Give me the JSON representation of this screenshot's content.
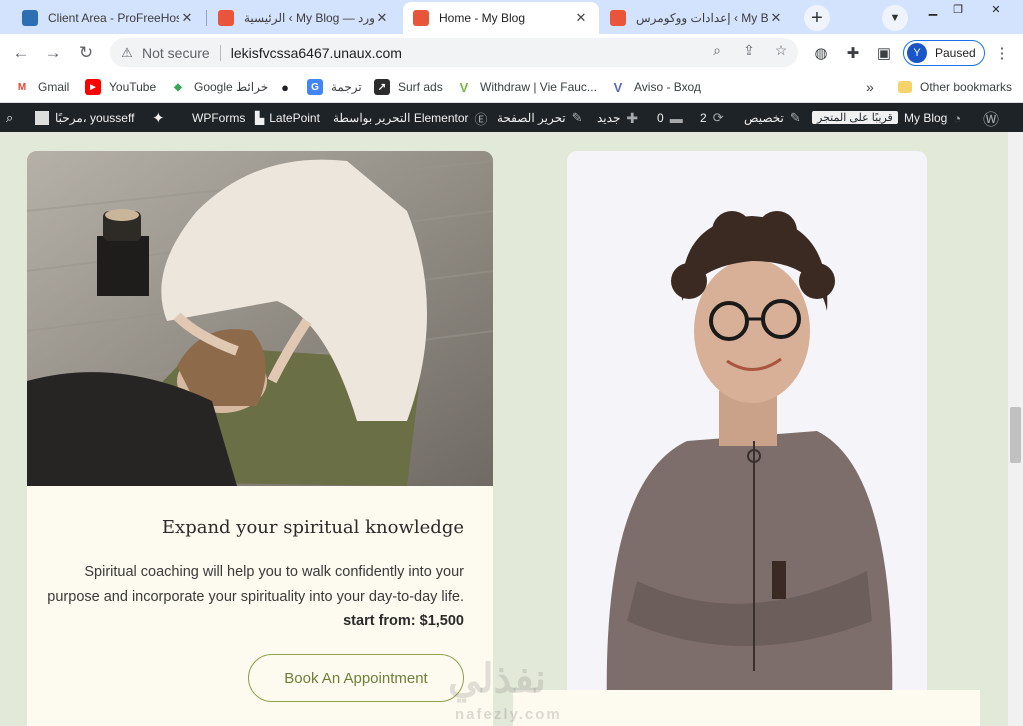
{
  "browser": {
    "tabs": [
      {
        "title": "Client Area - ProFreeHost",
        "icon": "profreehost-icon"
      },
      {
        "title": "الرئيسية ‹ My Blog — وورد...",
        "icon": "n-logo-icon"
      },
      {
        "title": "Home - My Blog",
        "icon": "n-logo-icon",
        "active": true
      },
      {
        "title": "إعدادات ووكومرس ‹ My Blog",
        "icon": "n-logo-icon"
      }
    ],
    "new_tab": "+",
    "address": {
      "security": "Not secure",
      "url": "lekisfvcssa6467.unaux.com"
    },
    "profile": {
      "initial": "Y",
      "status": "Paused"
    },
    "bookmarks": [
      {
        "label": "Gmail",
        "icon": "gmail-icon"
      },
      {
        "label": "YouTube",
        "icon": "youtube-icon"
      },
      {
        "label": "Google خرائط",
        "icon": "maps-icon"
      },
      {
        "label": "",
        "icon": "globe-icon"
      },
      {
        "label": "ترجمة",
        "icon": "translate-icon"
      },
      {
        "label": "Surf ads",
        "icon": "surf-icon"
      },
      {
        "label": "Withdraw | Vie Fauc...",
        "icon": "v-icon"
      },
      {
        "label": "Aviso - Вход",
        "icon": "aviso-icon"
      }
    ],
    "other_bookmarks": "Other bookmarks",
    "chevron": "»"
  },
  "adminbar": {
    "greeting": "مرحبًا، yousseff",
    "items": {
      "wpforms": "WPForms",
      "latepoint": "LatePoint",
      "elementor": "التحرير بواسطة Elementor",
      "edit_page": "تحرير الصفحة",
      "new": "جديد",
      "comments": "0",
      "updates": "2",
      "customize": "تخصيص",
      "store": "قريبًا على المتجر",
      "site": "My Blog"
    }
  },
  "content": {
    "card1": {
      "title": "Expand your spiritual knowledge",
      "description": "Spiritual coaching will help you to walk confidently into your purpose and incorporate your spirituality into your day-to-day life.",
      "price_label": "start from: $1,500",
      "button": "Book An Appointment"
    },
    "watermark": "نفذلي",
    "watermark_sub": "nafezly.com"
  },
  "colors": {
    "page_bg": "#e3e9d9",
    "card_bg": "#fdfbef",
    "button_border": "#8da24a",
    "adminbar": "#1d2327"
  }
}
